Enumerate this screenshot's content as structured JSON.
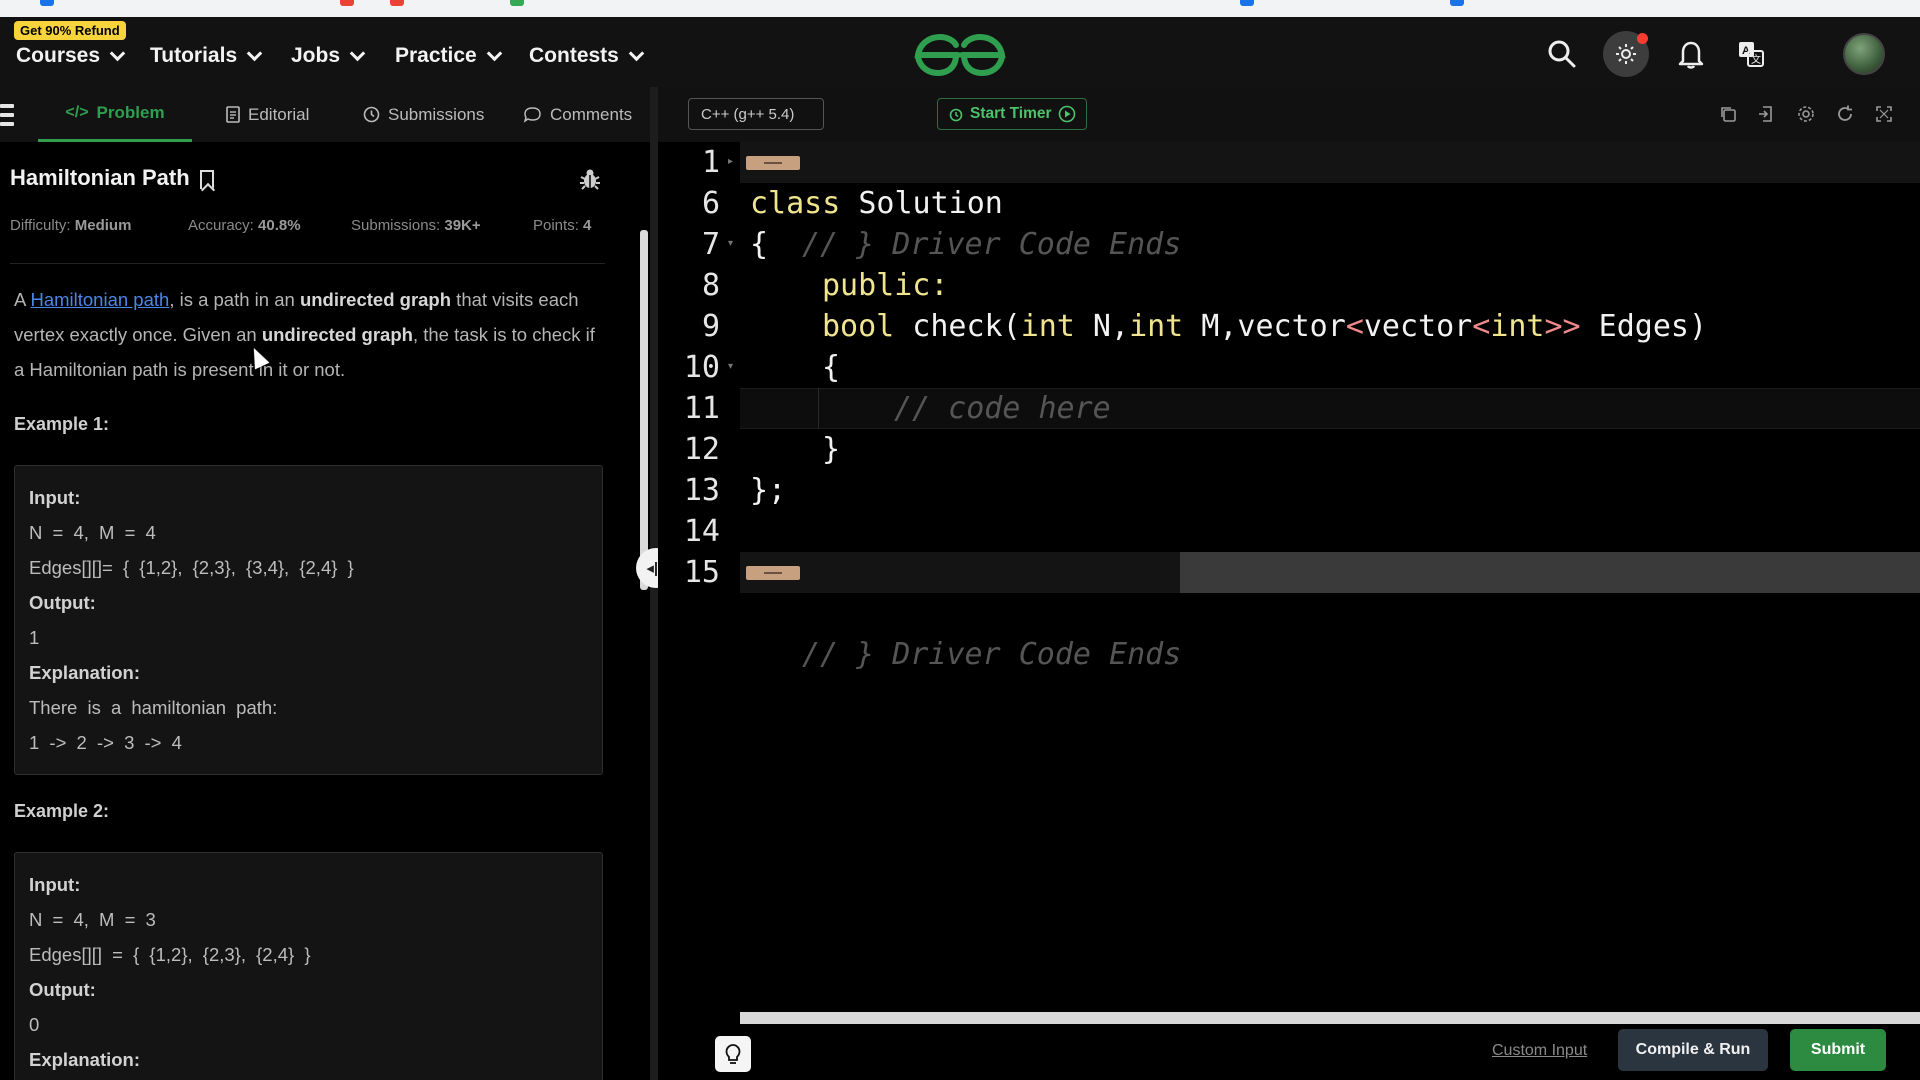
{
  "colors": {
    "accent_green": "#2f9e4f",
    "link_blue": "#4a86e8",
    "refund_badge": "#f7d33c",
    "keyword_yellow": "#f0e58e",
    "submit_green": "#2c8a41",
    "compile_bg": "#2b3540"
  },
  "topnav": {
    "refund_badge": "Get 90% Refund",
    "items": [
      "Courses",
      "Tutorials",
      "Jobs",
      "Practice",
      "Contests"
    ],
    "icons": [
      "search-icon",
      "theme-toggle-icon",
      "bell-icon",
      "translate-icon",
      "avatar"
    ]
  },
  "tabs": [
    {
      "label": "Problem",
      "icon": "code-icon",
      "active": true
    },
    {
      "label": "Editorial",
      "icon": "document-icon",
      "active": false
    },
    {
      "label": "Submissions",
      "icon": "clock-icon",
      "active": false
    },
    {
      "label": "Comments",
      "icon": "chat-icon",
      "active": false
    }
  ],
  "problem": {
    "title": "Hamiltonian Path",
    "meta": {
      "difficulty_label": "Difficulty:",
      "difficulty": "Medium",
      "accuracy_label": "Accuracy:",
      "accuracy": "40.8%",
      "submissions_label": "Submissions:",
      "submissions": "39K+",
      "points_label": "Points:",
      "points": "4"
    },
    "description": {
      "a": "A ",
      "link": "Hamiltonian path",
      "b": ", is a path in an ",
      "bold1": "undirected graph",
      "c": " that visits each vertex exactly once. Given an ",
      "bold2": "undirected graph",
      "d": ", the task is to check if a Hamiltonian path is present in it or not."
    },
    "examples": [
      {
        "title": "Example 1:",
        "input_label": "Input:",
        "input_line1": "N = 4, M = 4",
        "input_line2": "Edges[][]= { {1,2}, {2,3}, {3,4}, {2,4} }",
        "output_label": "Output:",
        "output": "1",
        "explanation_label": "Explanation:",
        "explanation_line1": "There is a hamiltonian path:",
        "explanation_line2": "1 -> 2 -> 3 -> 4"
      },
      {
        "title": "Example 2:",
        "input_label": "Input:",
        "input_line1": "N = 4, M = 3",
        "input_line2": "Edges[][] = { {1,2}, {2,3}, {2,4} }",
        "output_label": "Output:",
        "output": "0",
        "explanation_label": "Explanation:"
      }
    ]
  },
  "editor": {
    "language": "C++ (g++ 5.4)",
    "start_timer": "Start Timer",
    "toolbar_icons": [
      "copy-icon",
      "export-icon",
      "settings-icon",
      "reset-icon",
      "fullscreen-icon"
    ],
    "lines": [
      {
        "num": "1",
        "text": "// } Driver Code Ends"
      },
      {
        "num": "6",
        "text": "class Solution"
      },
      {
        "num": "7",
        "text": "{"
      },
      {
        "num": "8",
        "text": "public:"
      },
      {
        "num": "9",
        "text": "bool check(int N,int M,vector<vector<int>> Edges)"
      },
      {
        "num": "10",
        "text": "{"
      },
      {
        "num": "11",
        "text": "// code here"
      },
      {
        "num": "12",
        "text": "}"
      },
      {
        "num": "13",
        "text": "};"
      },
      {
        "num": "14",
        "text": ""
      },
      {
        "num": "15",
        "text": "// } Driver Code Ends"
      }
    ]
  },
  "bottom": {
    "custom_input": "Custom Input",
    "compile_run": "Compile & Run",
    "submit": "Submit"
  }
}
